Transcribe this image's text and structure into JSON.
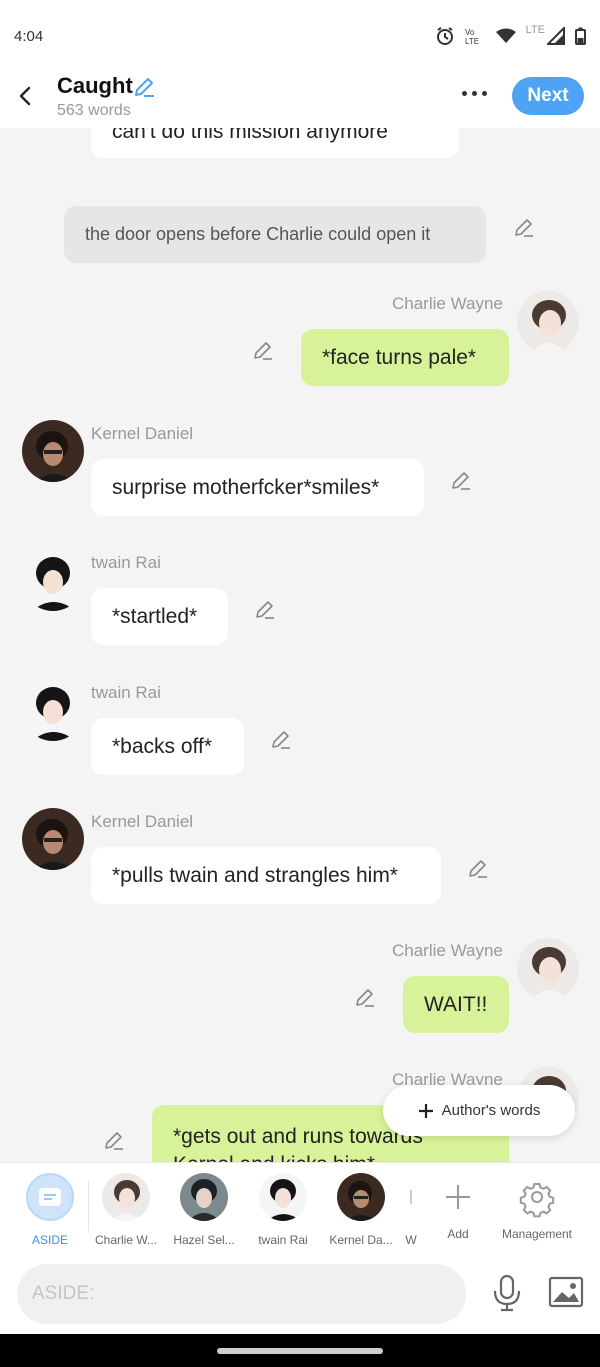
{
  "status": {
    "time": "4:04",
    "network": "LTE"
  },
  "header": {
    "title": "Caught",
    "word_count": "563 words",
    "next_label": "Next"
  },
  "messages": [
    {
      "text": "can't do this mission anymore"
    },
    {
      "text": "the door opens before Charlie could open it"
    },
    {
      "speaker": "Charlie Wayne",
      "text": "*face turns pale*"
    },
    {
      "speaker": "Kernel Daniel",
      "text": "surprise motherfcker*smiles*"
    },
    {
      "speaker": "twain Rai",
      "text": "*startled*"
    },
    {
      "speaker": "twain Rai",
      "text": "*backs off*"
    },
    {
      "speaker": "Kernel Daniel",
      "text": "*pulls twain and strangles him*"
    },
    {
      "speaker": "Charlie Wayne",
      "text": "WAIT!!"
    },
    {
      "speaker": "Charlie Wayne",
      "text": "*gets out and runs towards Kernel and kicks him*"
    }
  ],
  "floating": {
    "authors_words": "Author's words"
  },
  "characters": [
    {
      "label": "ASIDE"
    },
    {
      "label": "Charlie W..."
    },
    {
      "label": "Hazel Sel..."
    },
    {
      "label": "twain Rai"
    },
    {
      "label": "Kernel Da..."
    },
    {
      "label": "W"
    }
  ],
  "actions": {
    "add": "Add",
    "management": "Management"
  },
  "input": {
    "placeholder": "ASIDE:"
  },
  "colors": {
    "accent": "#4ea3f5",
    "user_bubble": "#d8f29a",
    "other_bubble": "#ffffff",
    "narration_bubble": "#e6e6e6"
  }
}
